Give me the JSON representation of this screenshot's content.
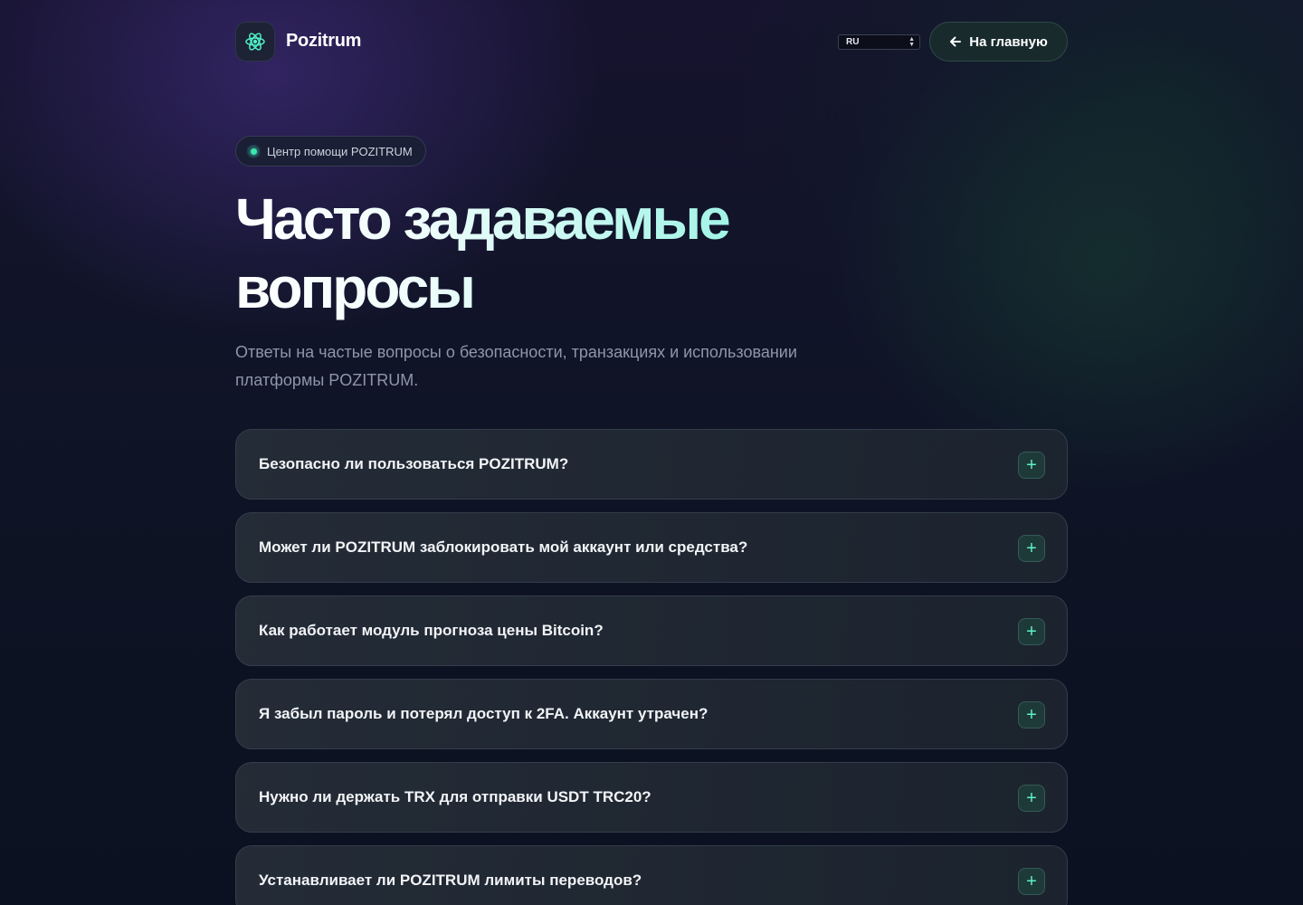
{
  "header": {
    "brand": "Pozitrum",
    "logo_icon": "atom-icon",
    "language": "RU",
    "home_button": "На главную",
    "home_icon": "arrow-left-icon"
  },
  "hero": {
    "badge": "Центр помощи POZITRUM",
    "title_line1": "Часто задаваемые",
    "title_line2": "вопросы",
    "subtitle": "Ответы на частые вопросы о безопасности, транзакциях и использовании платформы POZITRUM."
  },
  "faq": {
    "items": [
      {
        "question": "Безопасно ли пользоваться POZITRUM?"
      },
      {
        "question": "Может ли POZITRUM заблокировать мой аккаунт или средства?"
      },
      {
        "question": "Как работает модуль прогноза цены Bitcoin?"
      },
      {
        "question": "Я забыл пароль и потерял доступ к 2FA. Аккаунт утрачен?"
      },
      {
        "question": "Нужно ли держать TRX для отправки USDT TRC20?"
      },
      {
        "question": "Устанавливает ли POZITRUM лимиты переводов?"
      }
    ],
    "expand_symbol": "+"
  },
  "colors": {
    "accent": "#3ee6b0",
    "background": "#0f1426"
  }
}
